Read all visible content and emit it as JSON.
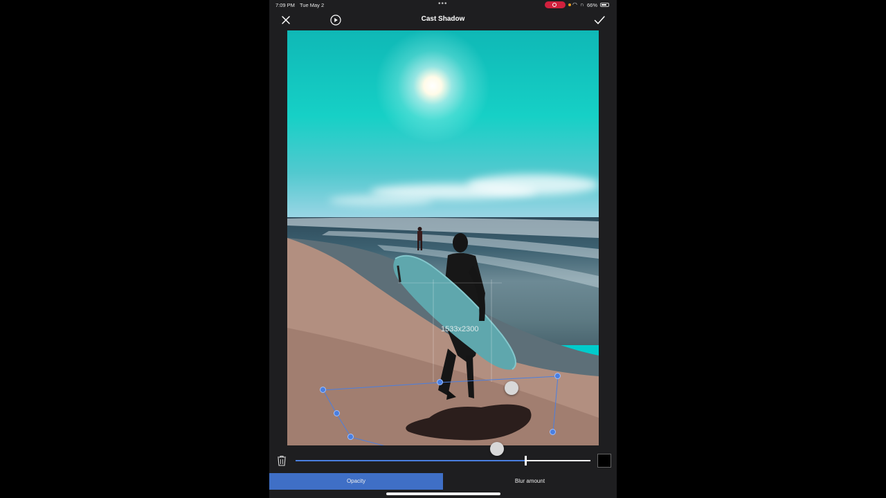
{
  "status_bar": {
    "time": "7:09 PM",
    "date": "Tue May 2",
    "multitask_dots": "•••",
    "battery": "66%"
  },
  "toolbar": {
    "title": "Cast Shadow",
    "close_icon": "close-icon",
    "play_icon": "play-icon",
    "confirm_icon": "checkmark-icon"
  },
  "canvas": {
    "dimensions_label": "1533x2300"
  },
  "slider": {
    "value_fraction": 0.78,
    "delete_icon": "trash-icon",
    "color_swatch": "#000000",
    "accent": "#4a7fe0"
  },
  "tabs": [
    {
      "label": "Opacity",
      "active": true
    },
    {
      "label": "Blur amount",
      "active": false
    }
  ]
}
